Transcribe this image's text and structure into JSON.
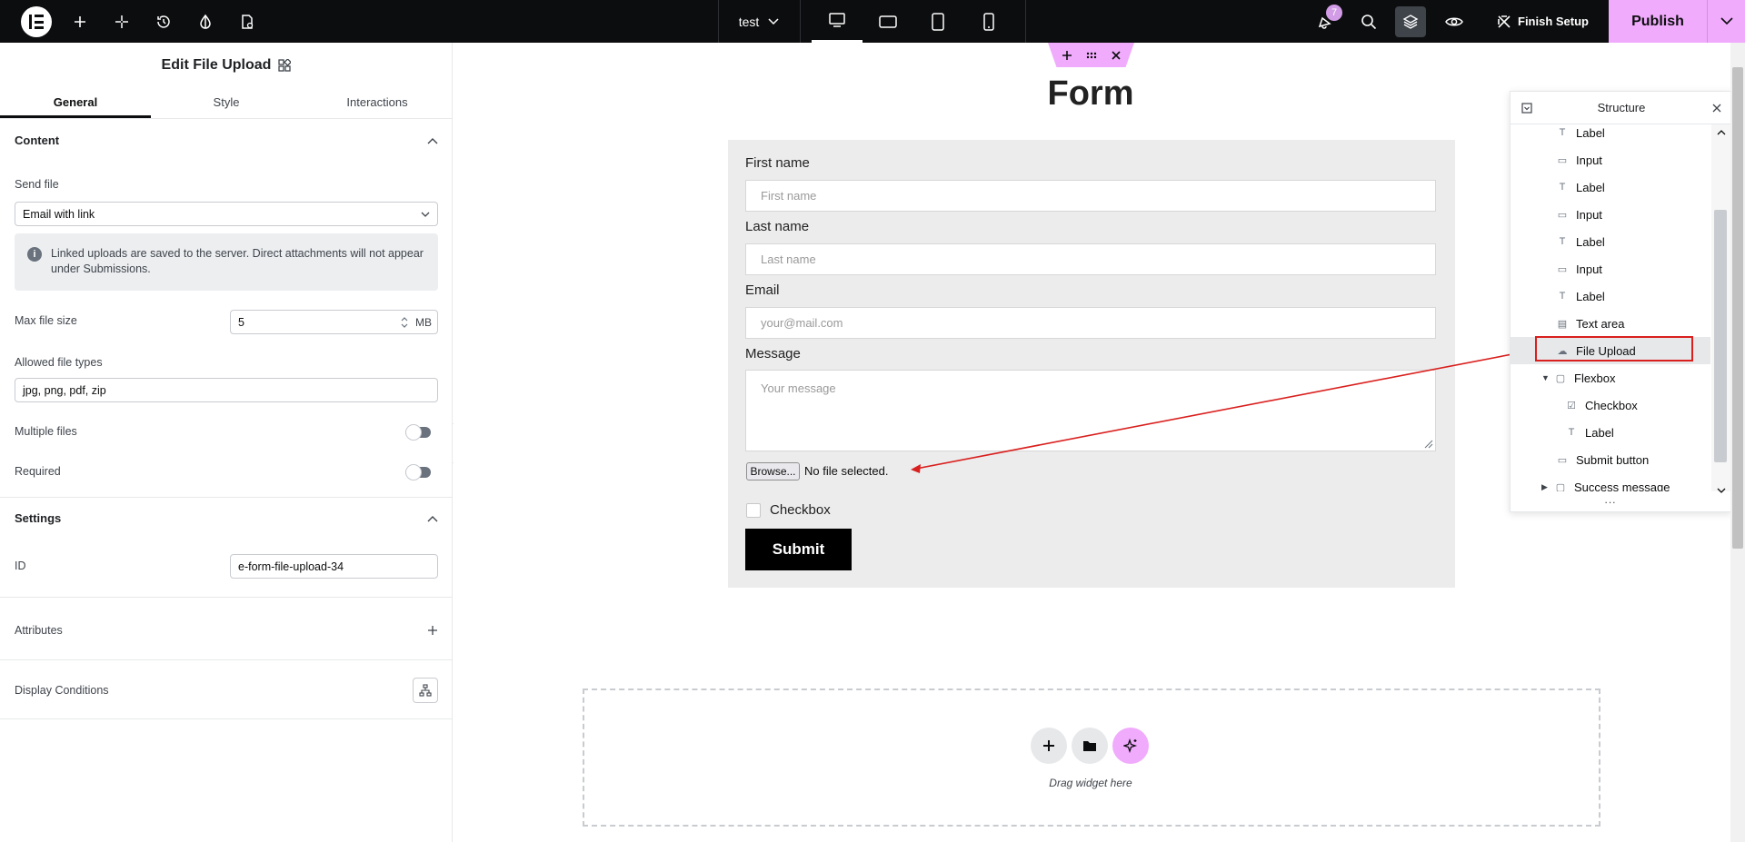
{
  "topbar": {
    "page_name": "test",
    "notifications_count": "7",
    "finish_setup_label": "Finish Setup",
    "publish_label": "Publish"
  },
  "panel": {
    "title": "Edit File Upload",
    "tabs": [
      "General",
      "Style",
      "Interactions"
    ],
    "content_section": "Content",
    "send_file_label": "Send file",
    "send_file_value": "Email with link",
    "info_text": "Linked uploads are saved to the server. Direct attachments will not appear under Submissions.",
    "max_file_size_label": "Max file size",
    "max_file_size_value": "5",
    "max_file_size_unit": "MB",
    "allowed_types_label": "Allowed file types",
    "allowed_types_value": "jpg, png, pdf, zip",
    "multiple_files_label": "Multiple files",
    "multiple_files_on": false,
    "required_label": "Required",
    "required_on": false,
    "settings_section": "Settings",
    "id_label": "ID",
    "id_value": "e-form-file-upload-34",
    "attributes_label": "Attributes",
    "display_conditions_label": "Display Conditions"
  },
  "canvas": {
    "form_title": "Form",
    "first_name_label": "First name",
    "first_name_placeholder": "First name",
    "last_name_label": "Last name",
    "last_name_placeholder": "Last name",
    "email_label": "Email",
    "email_placeholder": "your@mail.com",
    "message_label": "Message",
    "message_placeholder": "Your message",
    "browse_label": "Browse...",
    "no_file_text": "No file selected.",
    "checkbox_label": "Checkbox",
    "submit_label": "Submit",
    "drag_widget_text": "Drag widget here"
  },
  "structure": {
    "title": "Structure",
    "items": [
      {
        "label": "Label",
        "icon": "text-icon"
      },
      {
        "label": "Input",
        "icon": "input-icon"
      },
      {
        "label": "Label",
        "icon": "text-icon"
      },
      {
        "label": "Input",
        "icon": "input-icon"
      },
      {
        "label": "Label",
        "icon": "text-icon"
      },
      {
        "label": "Input",
        "icon": "input-icon"
      },
      {
        "label": "Label",
        "icon": "text-icon"
      },
      {
        "label": "Text area",
        "icon": "textarea-icon"
      },
      {
        "label": "File Upload",
        "icon": "upload-cloud-icon"
      },
      {
        "label": "Flexbox",
        "icon": "flexbox-icon"
      },
      {
        "label": "Checkbox",
        "icon": "checkbox-icon"
      },
      {
        "label": "Label",
        "icon": "text-icon"
      },
      {
        "label": "Submit button",
        "icon": "button-icon"
      },
      {
        "label": "Success message",
        "icon": "flexbox-icon"
      }
    ],
    "more": "..."
  },
  "colors": {
    "accent": "#f0abfc",
    "annotation": "#d9201e"
  }
}
